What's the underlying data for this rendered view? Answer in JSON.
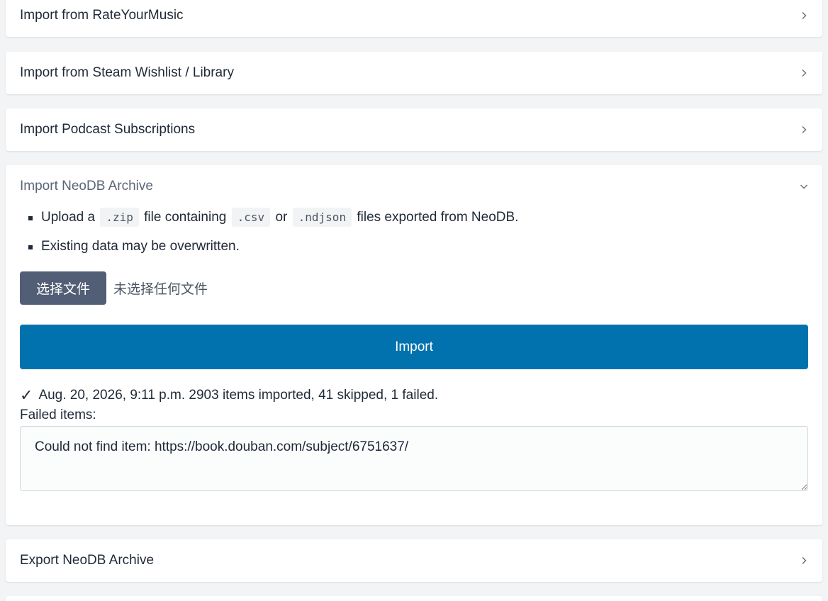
{
  "sections": {
    "rym": {
      "title": "Import from RateYourMusic"
    },
    "steam": {
      "title": "Import from Steam Wishlist / Library"
    },
    "podcast": {
      "title": "Import Podcast Subscriptions"
    },
    "neodb_import": {
      "title": "Import NeoDB Archive",
      "note1": {
        "prefix": "Upload a",
        "code1": ".zip",
        "middle": "file containing",
        "code2": ".csv",
        "or": "or",
        "code3": ".ndjson",
        "suffix": "files exported from NeoDB."
      },
      "note2": "Existing data may be overwritten.",
      "file_button": "选择文件",
      "file_status": "未选择任何文件",
      "import_button": "Import",
      "status_icon": "✓",
      "status_text": "Aug. 20, 2026, 9:11 p.m. 2903 items imported, 41 skipped, 1 failed.",
      "failed_label": "Failed items:",
      "failed_items": "Could not find item: https://book.douban.com/subject/6751637/"
    },
    "neodb_export": {
      "title": "Export NeoDB Archive"
    }
  },
  "icons": {
    "collapsed": "chevron-right-icon",
    "expanded": "chevron-down-icon"
  },
  "colors": {
    "primary": "#0172ad",
    "secondary": "#525e75",
    "background": "#f3f4f6"
  }
}
